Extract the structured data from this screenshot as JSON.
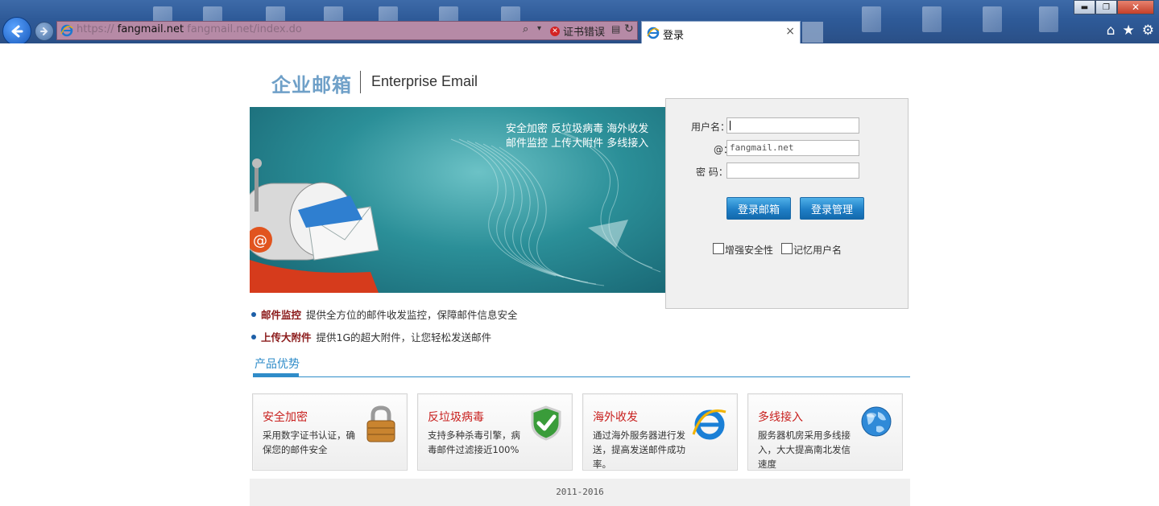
{
  "browser": {
    "url_prefix": "https://",
    "url_domain": "fangmail.net",
    "url_path": "fangmail.net/index.do",
    "cert_error": "证书错误",
    "tab_title": "登录",
    "tab_close": "×",
    "win_min": "▬",
    "win_max": "❐",
    "win_close": "✕",
    "home_icon": "⌂",
    "fav_icon": "★",
    "settings_icon": "⚙"
  },
  "header": {
    "logo_cn": "企业邮箱",
    "logo_en": "Enterprise Email"
  },
  "banner": {
    "features_row1": "安全加密   反垃圾病毒   海外收发",
    "features_row2": "邮件监控   上传大附件   多线接入"
  },
  "login": {
    "username_label": "用户名：",
    "username_value": "",
    "domain_label": "@：",
    "domain_value": "fangmail.net",
    "password_label": "密  码：",
    "login_button": "登录邮箱",
    "admin_button": "登录管理",
    "enhance_security": "增强安全性",
    "remember_user": "记忆用户名"
  },
  "bullets": [
    {
      "title": "邮件监控",
      "text": "提供全方位的邮件收发监控，保障邮件信息安全"
    },
    {
      "title": "上传大附件",
      "text": "提供1G的超大附件，让您轻松发送邮件"
    }
  ],
  "section_title": "产品优势",
  "cards": [
    {
      "title": "安全加密",
      "desc": "采用数字证书认证，确保您的邮件安全",
      "icon": "lock-icon"
    },
    {
      "title": "反垃圾病毒",
      "desc": "支持多种杀毒引擎，病毒邮件过滤接近100%",
      "icon": "shield-check-icon"
    },
    {
      "title": "海外收发",
      "desc": "通过海外服务器进行发送，提高发送邮件成功率。",
      "icon": "ie-globe-icon"
    },
    {
      "title": "多线接入",
      "desc": "服务器机房采用多线接入，大大提高南北发信速度",
      "icon": "globe-icon"
    }
  ],
  "footer": "2011-2016",
  "colors": {
    "accent_blue": "#2f8cc9",
    "card_title_red": "#c8201e",
    "bullet_title_red": "#8b1a1a",
    "address_bar_error": "#b68aa6"
  }
}
